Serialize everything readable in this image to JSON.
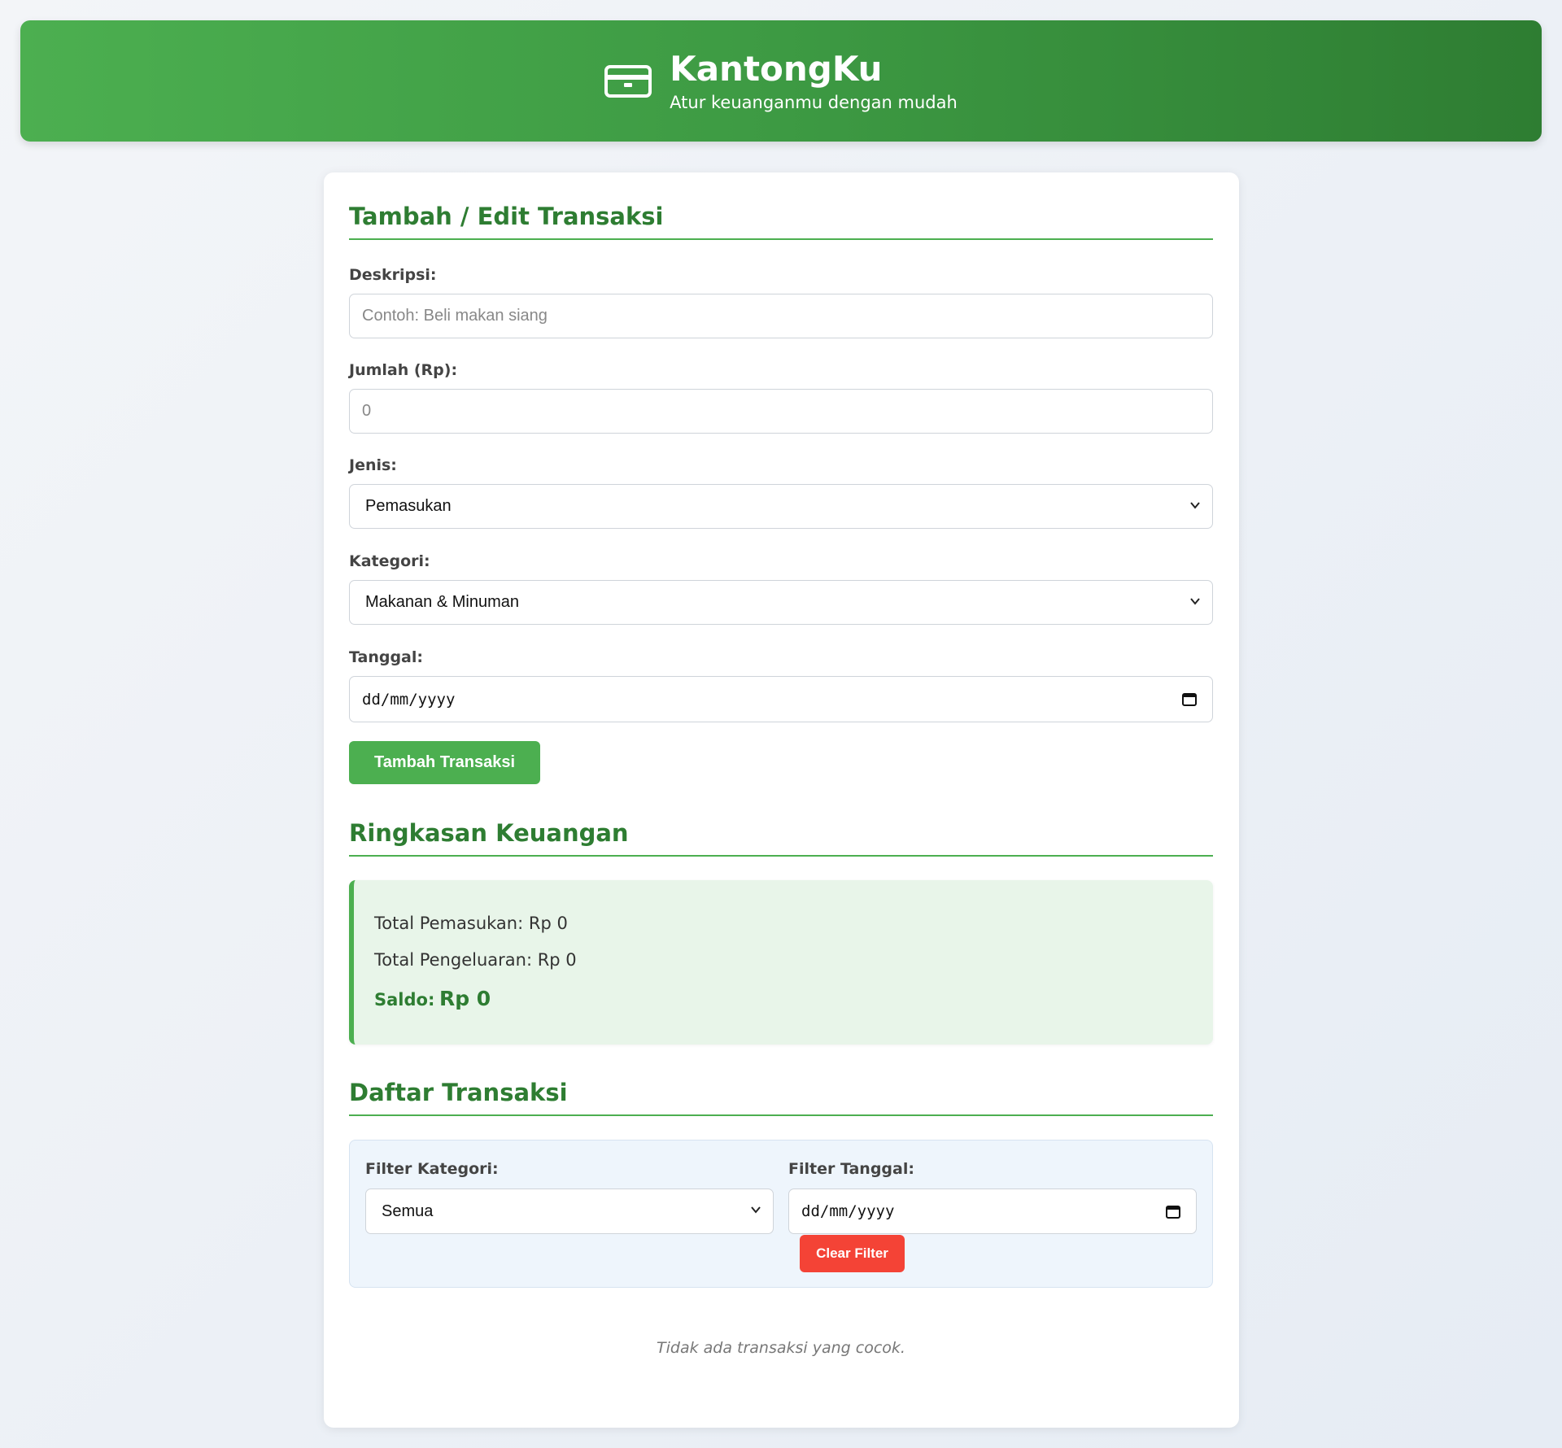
{
  "header": {
    "title": "KantongKu",
    "subtitle": "Atur keuanganmu dengan mudah",
    "icon": "wallet-card-icon"
  },
  "form": {
    "title": "Tambah / Edit Transaksi",
    "description_label": "Deskripsi:",
    "description_placeholder": "Contoh: Beli makan siang",
    "description_value": "",
    "amount_label": "Jumlah (Rp):",
    "amount_placeholder": "0",
    "amount_value": "",
    "type_label": "Jenis:",
    "type_selected": "Pemasukan",
    "category_label": "Kategori:",
    "category_selected": "Makanan & Minuman",
    "date_label": "Tanggal:",
    "date_placeholder": "dd/mm/yyyy",
    "submit_label": "Tambah Transaksi"
  },
  "summary": {
    "title": "Ringkasan Keuangan",
    "income_text": "Total Pemasukan: Rp 0",
    "expense_text": "Total Pengeluaran: Rp 0",
    "balance_label": "Saldo:",
    "balance_value": "Rp 0"
  },
  "transactions": {
    "title": "Daftar Transaksi",
    "filter_category_label": "Filter Kategori:",
    "filter_category_selected": "Semua",
    "filter_date_label": "Filter Tanggal:",
    "filter_date_placeholder": "dd/mm/yyyy",
    "clear_filter_label": "Clear Filter",
    "empty_message": "Tidak ada transaksi yang cocok."
  },
  "colors": {
    "primary": "#4caf50",
    "primary_dark": "#2e7d32",
    "danger": "#f44336",
    "summary_bg": "#e8f5e9",
    "filter_bg": "#eef5fc"
  }
}
